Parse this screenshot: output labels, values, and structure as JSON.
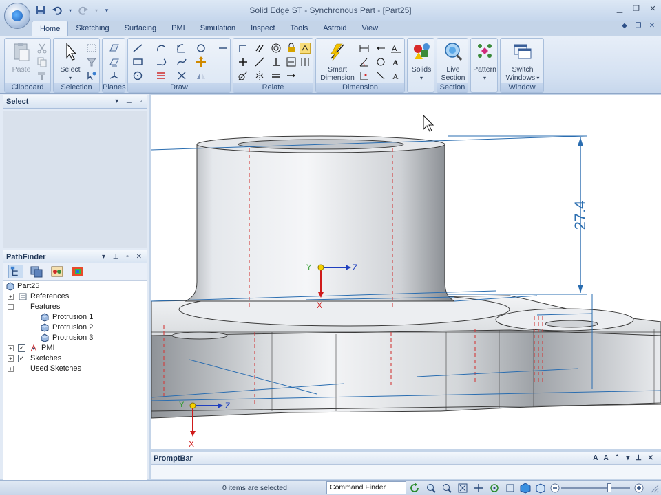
{
  "window": {
    "title": "Solid Edge ST - Synchronous Part - [Part25]",
    "controls": [
      "minimize",
      "restore",
      "close"
    ]
  },
  "quick_access": {
    "icons": [
      "save-icon",
      "undo-icon",
      "redo-icon",
      "customize-icon"
    ]
  },
  "tabs": [
    {
      "label": "Home",
      "active": true
    },
    {
      "label": "Sketching"
    },
    {
      "label": "Surfacing"
    },
    {
      "label": "PMI"
    },
    {
      "label": "Simulation"
    },
    {
      "label": "Inspect"
    },
    {
      "label": "Tools"
    },
    {
      "label": "Astroid"
    },
    {
      "label": "View"
    }
  ],
  "ribbon": {
    "groups": {
      "clipboard": "Clipboard",
      "selection": "Selection",
      "planes": "Planes",
      "draw": "Draw",
      "relate": "Relate",
      "dimension": "Dimension",
      "solids": "Solids",
      "section": "Section",
      "pattern": "Pattern",
      "window": "Window"
    },
    "buttons": {
      "paste": "Paste",
      "select": "Select",
      "smart_dimension_1": "Smart",
      "smart_dimension_2": "Dimension",
      "solids": "Solids",
      "live_section_1": "Live",
      "live_section_2": "Section",
      "pattern": "Pattern",
      "switch_windows_1": "Switch",
      "switch_windows_2": "Windows"
    }
  },
  "select_panel": {
    "title": "Select"
  },
  "pathfinder": {
    "title": "PathFinder",
    "tree": {
      "root": "Part25",
      "references": "References",
      "features": "Features",
      "protrusion_1": "Protrusion 1",
      "protrusion_2": "Protrusion 2",
      "protrusion_3": "Protrusion 3",
      "pmi": "PMI",
      "sketches": "Sketches",
      "used_sketches": "Used Sketches"
    }
  },
  "graphics": {
    "dimension_value": "27.4",
    "axis_labels": {
      "y": "Y",
      "z": "Z",
      "x": "X"
    }
  },
  "promptbar": {
    "title": "PromptBar"
  },
  "status": {
    "selection": "0 items are selected",
    "command_finder": "Command Finder",
    "zoom_level": 0.7
  },
  "colors": {
    "accent": "#1f5fb8",
    "dimension": "#2a6db0",
    "hidden_edge": "#d23b3b",
    "axis_z": "#1f3fbf",
    "axis_x": "#d01b1b",
    "axis_y": "#2a9a2a",
    "origin": "#f5d000"
  }
}
